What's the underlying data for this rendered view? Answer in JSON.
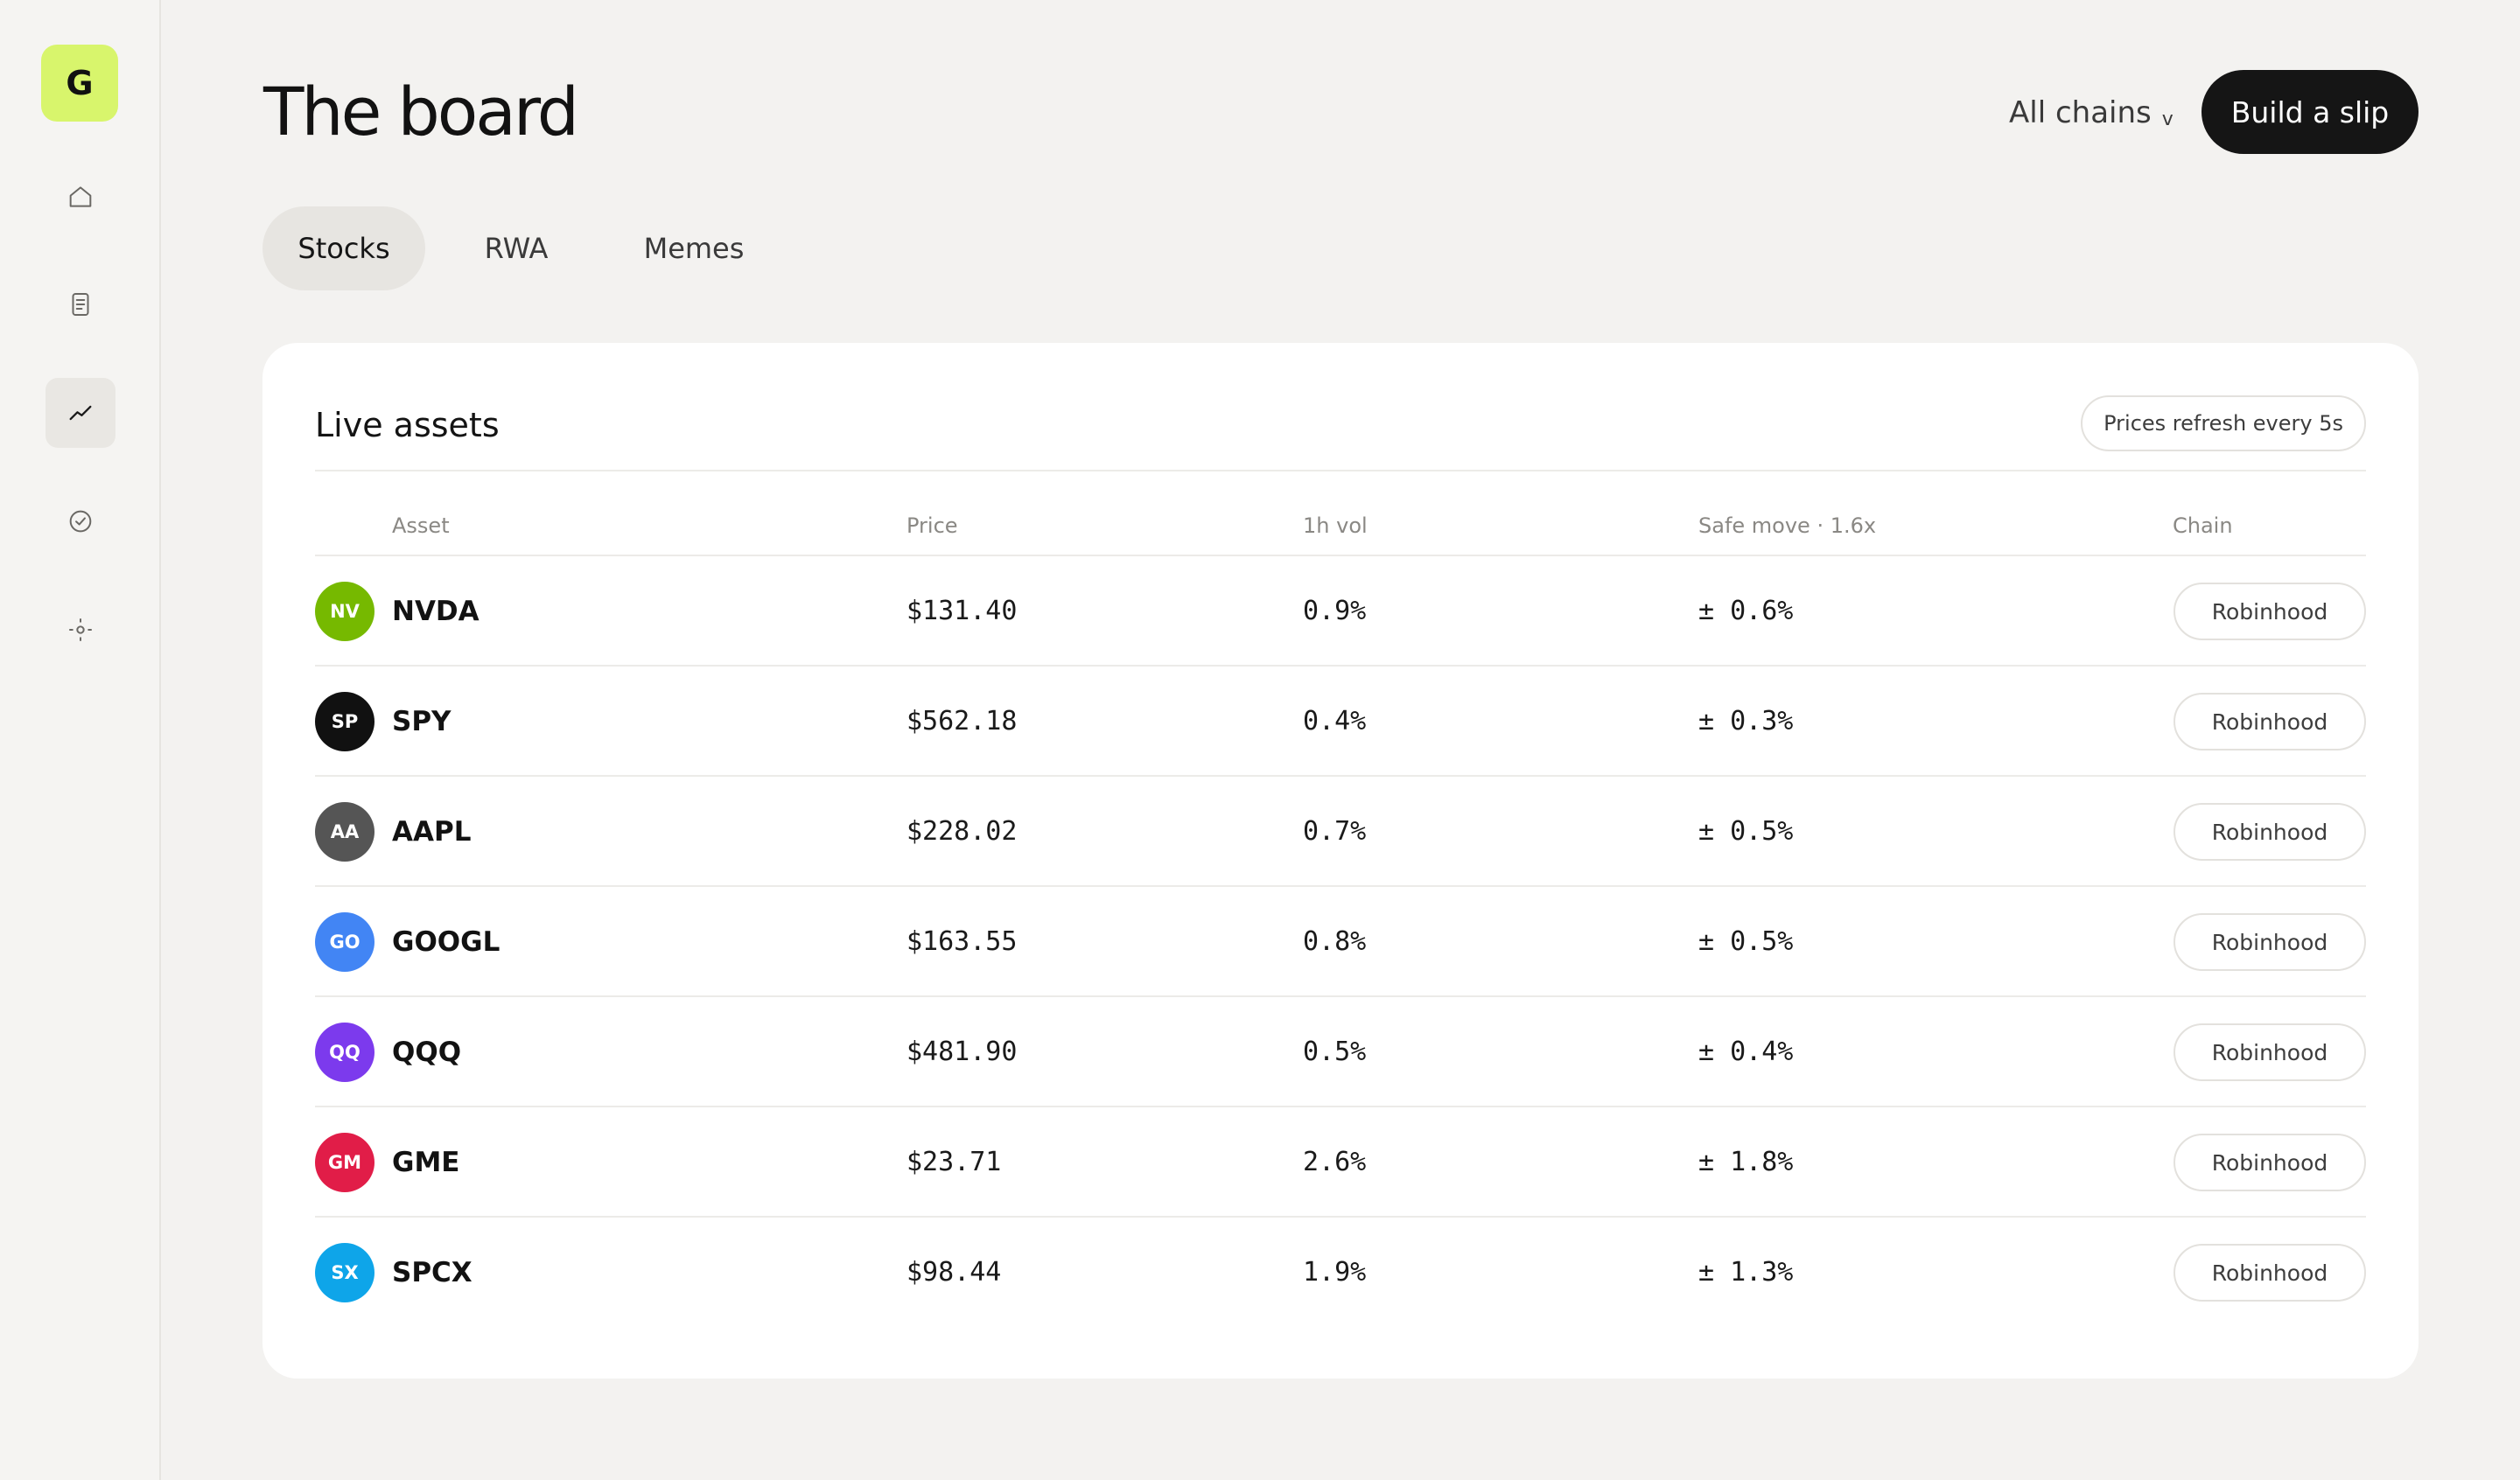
{
  "sidebar": {
    "logo_letter": "G",
    "items": [
      {
        "name": "home",
        "icon": "home-icon"
      },
      {
        "name": "slips",
        "icon": "document-icon"
      },
      {
        "name": "board",
        "icon": "trend-icon",
        "active": true
      },
      {
        "name": "settled",
        "icon": "check-circle-icon"
      },
      {
        "name": "settings",
        "icon": "sun-icon"
      }
    ]
  },
  "header": {
    "title": "The board",
    "chain_filter": "All chains",
    "chain_chevron": "v",
    "build_button": "Build a slip"
  },
  "tabs": [
    {
      "label": "Stocks",
      "active": true
    },
    {
      "label": "RWA",
      "active": false
    },
    {
      "label": "Memes",
      "active": false
    }
  ],
  "card": {
    "title": "Live assets",
    "refresh_note": "Prices refresh every 5s",
    "columns": {
      "asset": "Asset",
      "price": "Price",
      "vol": "1h vol",
      "safe": "Safe move · 1.6x",
      "chain": "Chain"
    },
    "rows": [
      {
        "initials": "NV",
        "ticker": "NVDA",
        "price": "$131.40",
        "vol": "0.9%",
        "safe": "± 0.6%",
        "chain": "Robinhood",
        "color": "#76b900"
      },
      {
        "initials": "SP",
        "ticker": "SPY",
        "price": "$562.18",
        "vol": "0.4%",
        "safe": "± 0.3%",
        "chain": "Robinhood",
        "color": "#111111"
      },
      {
        "initials": "AA",
        "ticker": "AAPL",
        "price": "$228.02",
        "vol": "0.7%",
        "safe": "± 0.5%",
        "chain": "Robinhood",
        "color": "#555555"
      },
      {
        "initials": "GO",
        "ticker": "GOOGL",
        "price": "$163.55",
        "vol": "0.8%",
        "safe": "± 0.5%",
        "chain": "Robinhood",
        "color": "#4285f4"
      },
      {
        "initials": "QQ",
        "ticker": "QQQ",
        "price": "$481.90",
        "vol": "0.5%",
        "safe": "± 0.4%",
        "chain": "Robinhood",
        "color": "#7c3aed"
      },
      {
        "initials": "GM",
        "ticker": "GME",
        "price": "$23.71",
        "vol": "2.6%",
        "safe": "± 1.8%",
        "chain": "Robinhood",
        "color": "#e11d48"
      },
      {
        "initials": "SX",
        "ticker": "SPCX",
        "price": "$98.44",
        "vol": "1.9%",
        "safe": "± 1.3%",
        "chain": "Robinhood",
        "color": "#0ea5e9"
      }
    ]
  },
  "colors": {
    "background": "#f3f2f0",
    "accent_logo": "#d8f56c",
    "primary_button": "#151515"
  }
}
